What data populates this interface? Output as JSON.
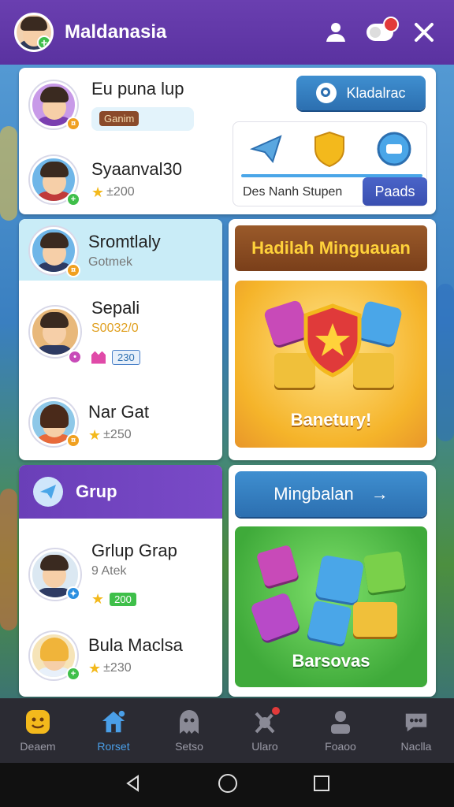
{
  "header": {
    "title": "Maldanasia",
    "icons": [
      "profile-icon",
      "toggle-icon",
      "close-icon"
    ]
  },
  "top_card": {
    "rows": [
      {
        "name": "Eu puna lup",
        "tag": "Ganim"
      },
      {
        "name": "Syaanval30",
        "points": "±200"
      }
    ],
    "action_button": "Kladalrac",
    "icons": [
      "paper-plane-icon",
      "shield-icon",
      "chat-bubble-icon"
    ],
    "caption": "Des Nanh Stupen",
    "caption_button": "Paads"
  },
  "players": [
    {
      "name": "Sromtlaly",
      "sub": "Gotmek"
    },
    {
      "name": "Sepali",
      "sub": "S0032/0",
      "badge": "230"
    },
    {
      "name": "Nar Gat",
      "points": "±250"
    }
  ],
  "group": {
    "title": "Grup",
    "members": [
      {
        "name": "Grlup Grap",
        "sub": "9 Atek",
        "badge": "200"
      },
      {
        "name": "Bula Maclsa",
        "points": "±230"
      }
    ]
  },
  "reward_panel": {
    "title": "Hadilah Minguauan",
    "caption": "Banetury!"
  },
  "match_panel": {
    "button": "Mingbalan",
    "caption": "Barsovas"
  },
  "bottom_nav": [
    {
      "label": "Deaem",
      "icon": "smiley-icon",
      "active": false
    },
    {
      "label": "Rorset",
      "icon": "home-icon",
      "active": true
    },
    {
      "label": "Setso",
      "icon": "ghost-icon",
      "active": false
    },
    {
      "label": "Ularo",
      "icon": "robot-icon",
      "active": false
    },
    {
      "label": "Foaoo",
      "icon": "person-icon",
      "active": false
    },
    {
      "label": "Naclla",
      "icon": "chat-icon",
      "active": false
    }
  ],
  "colors": {
    "header": "#5a32a0",
    "accent_blue": "#2c6fb0",
    "gold": "#f3b91c"
  }
}
